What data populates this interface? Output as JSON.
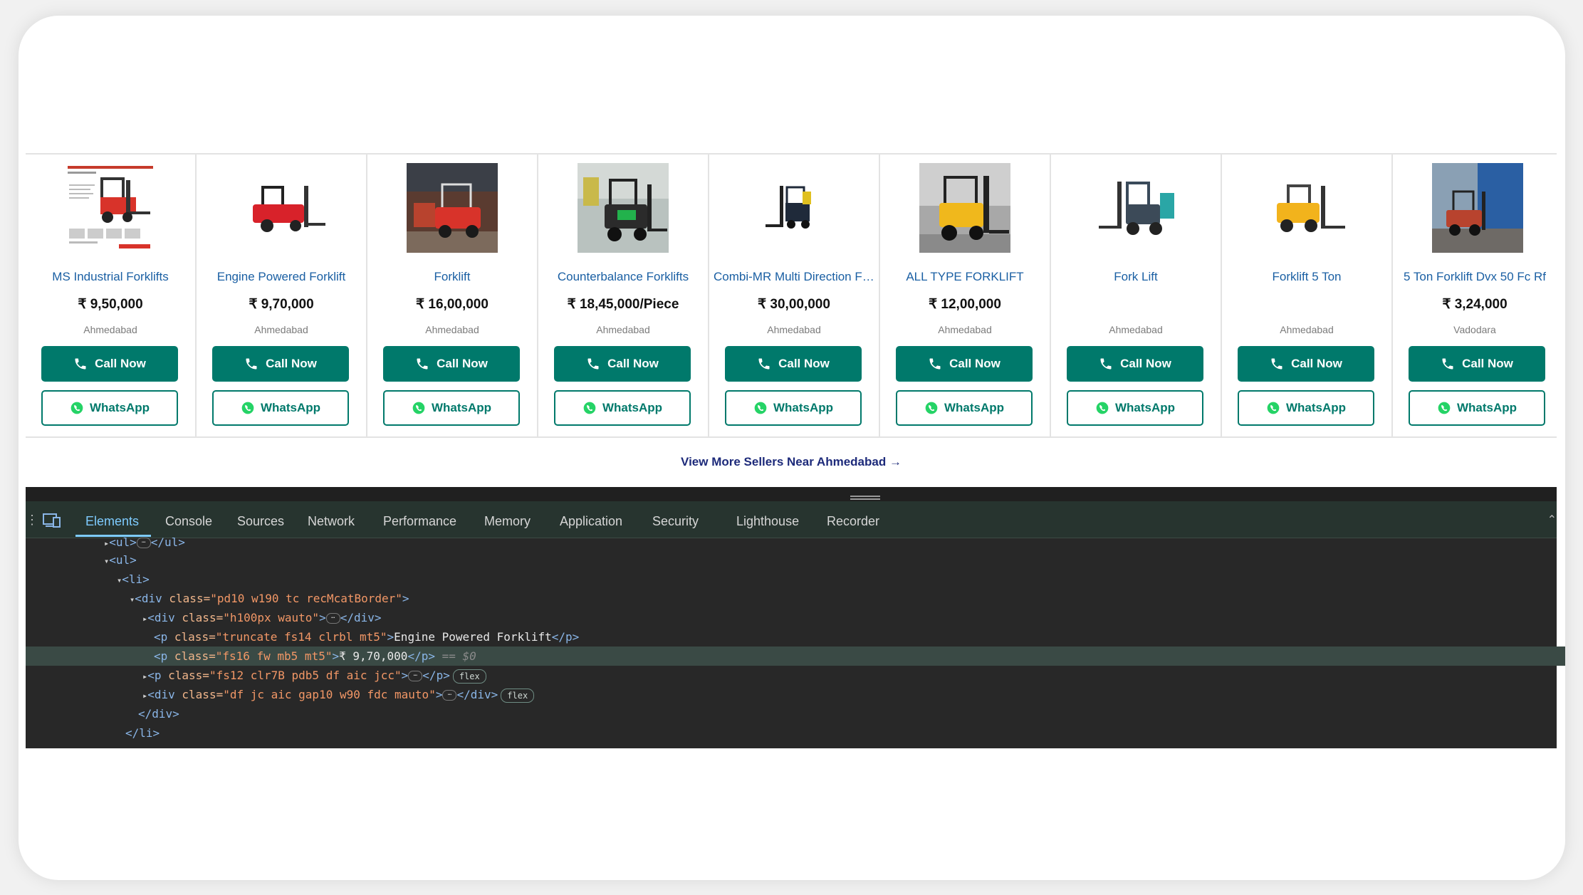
{
  "products": [
    {
      "name": "MS Industrial Forklifts",
      "price": "₹ 9,50,000",
      "city": "Ahmedabad",
      "call": "Call Now",
      "whatsapp": "WhatsApp"
    },
    {
      "name": "Engine Powered Forklift",
      "price": "₹ 9,70,000",
      "city": "Ahmedabad",
      "call": "Call Now",
      "whatsapp": "WhatsApp"
    },
    {
      "name": "Forklift",
      "price": "₹ 16,00,000",
      "city": "Ahmedabad",
      "call": "Call Now",
      "whatsapp": "WhatsApp"
    },
    {
      "name": "Counterbalance Forklifts",
      "price": "₹ 18,45,000/Piece",
      "city": "Ahmedabad",
      "call": "Call Now",
      "whatsapp": "WhatsApp"
    },
    {
      "name": "Combi-MR Multi Direction Forklift",
      "price": "₹ 30,00,000",
      "city": "Ahmedabad",
      "call": "Call Now",
      "whatsapp": "WhatsApp"
    },
    {
      "name": "ALL TYPE FORKLIFT",
      "price": "₹ 12,00,000",
      "city": "Ahmedabad",
      "call": "Call Now",
      "whatsapp": "WhatsApp"
    },
    {
      "name": "Fork Lift",
      "price": "",
      "city": "Ahmedabad",
      "call": "Call Now",
      "whatsapp": "WhatsApp"
    },
    {
      "name": "Forklift 5 Ton",
      "price": "",
      "city": "Ahmedabad",
      "call": "Call Now",
      "whatsapp": "WhatsApp"
    },
    {
      "name": "5 Ton Forklift Dvx 50 Fc Rf",
      "price": "₹ 3,24,000",
      "city": "Vadodara",
      "call": "Call Now",
      "whatsapp": "WhatsApp"
    }
  ],
  "view_more": "View More Sellers Near Ahmedabad →",
  "devtools": {
    "tabs": [
      "Elements",
      "Console",
      "Sources",
      "Network",
      "Performance",
      "Memory",
      "Application",
      "Security",
      "Lighthouse",
      "Recorder"
    ],
    "active_tab": "Elements",
    "tree": {
      "l0": "<ul>",
      "l0b": "</ul>",
      "l1": "<ul>",
      "l2": "<li>",
      "l3_tag": "<div ",
      "l3_attr": "class=",
      "l3_val": "\"pd10 w190 tc recMcatBorder\"",
      "l3_end": ">",
      "l4_tag": "<div ",
      "l4_attr": "class=",
      "l4_val": "\"h100px wauto\"",
      "l4_end": ">",
      "l4_close": "</div>",
      "l5_tag": "<p ",
      "l5_attr": "class=",
      "l5_val": "\"truncate fs14 clrbl mt5\"",
      "l5_end": ">",
      "l5_text": "Engine Powered Forklift",
      "l5_close": "</p>",
      "l6_tag": "<p ",
      "l6_attr": "class=",
      "l6_val": "\"fs16 fw mb5 mt5\"",
      "l6_end": ">",
      "l6_text": "₹ 9,70,000",
      "l6_close": "</p>",
      "l6_eq": "== $0",
      "l7_tag": "<p ",
      "l7_attr": "class=",
      "l7_val": "\"fs12 clr7B pdb5 df aic jcc\"",
      "l7_end": ">",
      "l7_close": "</p>",
      "l7_badge": "flex",
      "l8_tag": "<div ",
      "l8_attr": "class=",
      "l8_val": "\"df jc aic gap10 w90 fdc mauto\"",
      "l8_end": ">",
      "l8_close": "</div>",
      "l8_badge": "flex",
      "l9": "</div>",
      "l10": "</li>"
    }
  }
}
